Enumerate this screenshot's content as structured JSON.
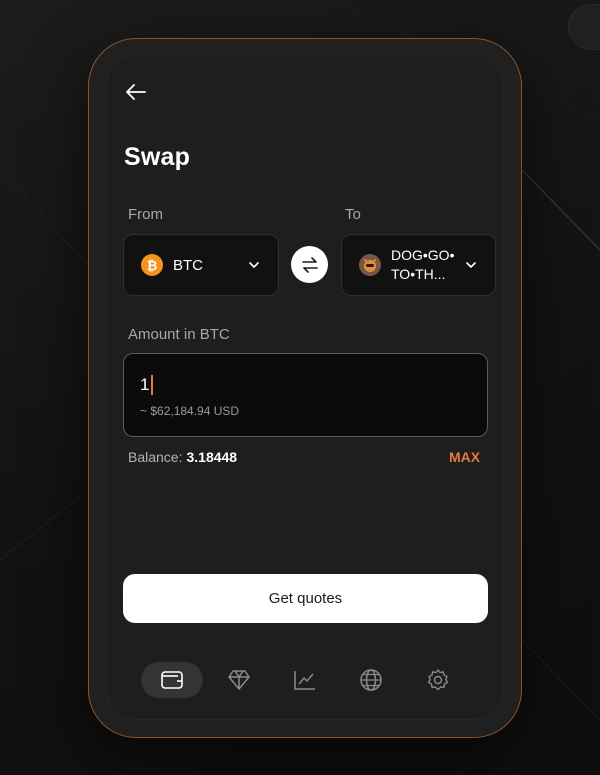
{
  "header": {
    "title": "Swap"
  },
  "from": {
    "label": "From",
    "token": "BTC",
    "icon": "bitcoin-icon",
    "icon_color": "#f7931a"
  },
  "to": {
    "label": "To",
    "token": "DOG•GO•TO•TH..."
  },
  "amount": {
    "label": "Amount in BTC",
    "value": "1",
    "usd_equivalent": "~ $62,184.94 USD"
  },
  "balance": {
    "label": "Balance:",
    "value": "3.18448"
  },
  "max_label": "MAX",
  "cta": {
    "label": "Get quotes"
  },
  "nav": {
    "items": [
      {
        "icon": "wallet-icon",
        "active": true
      },
      {
        "icon": "diamond-icon",
        "active": false
      },
      {
        "icon": "chart-icon",
        "active": false
      },
      {
        "icon": "globe-icon",
        "active": false
      },
      {
        "icon": "gear-icon",
        "active": false
      }
    ]
  },
  "colors": {
    "accent": "#e27a3c",
    "phone_border": "#8a5330",
    "background": "#141414",
    "button": "#ffffff"
  }
}
